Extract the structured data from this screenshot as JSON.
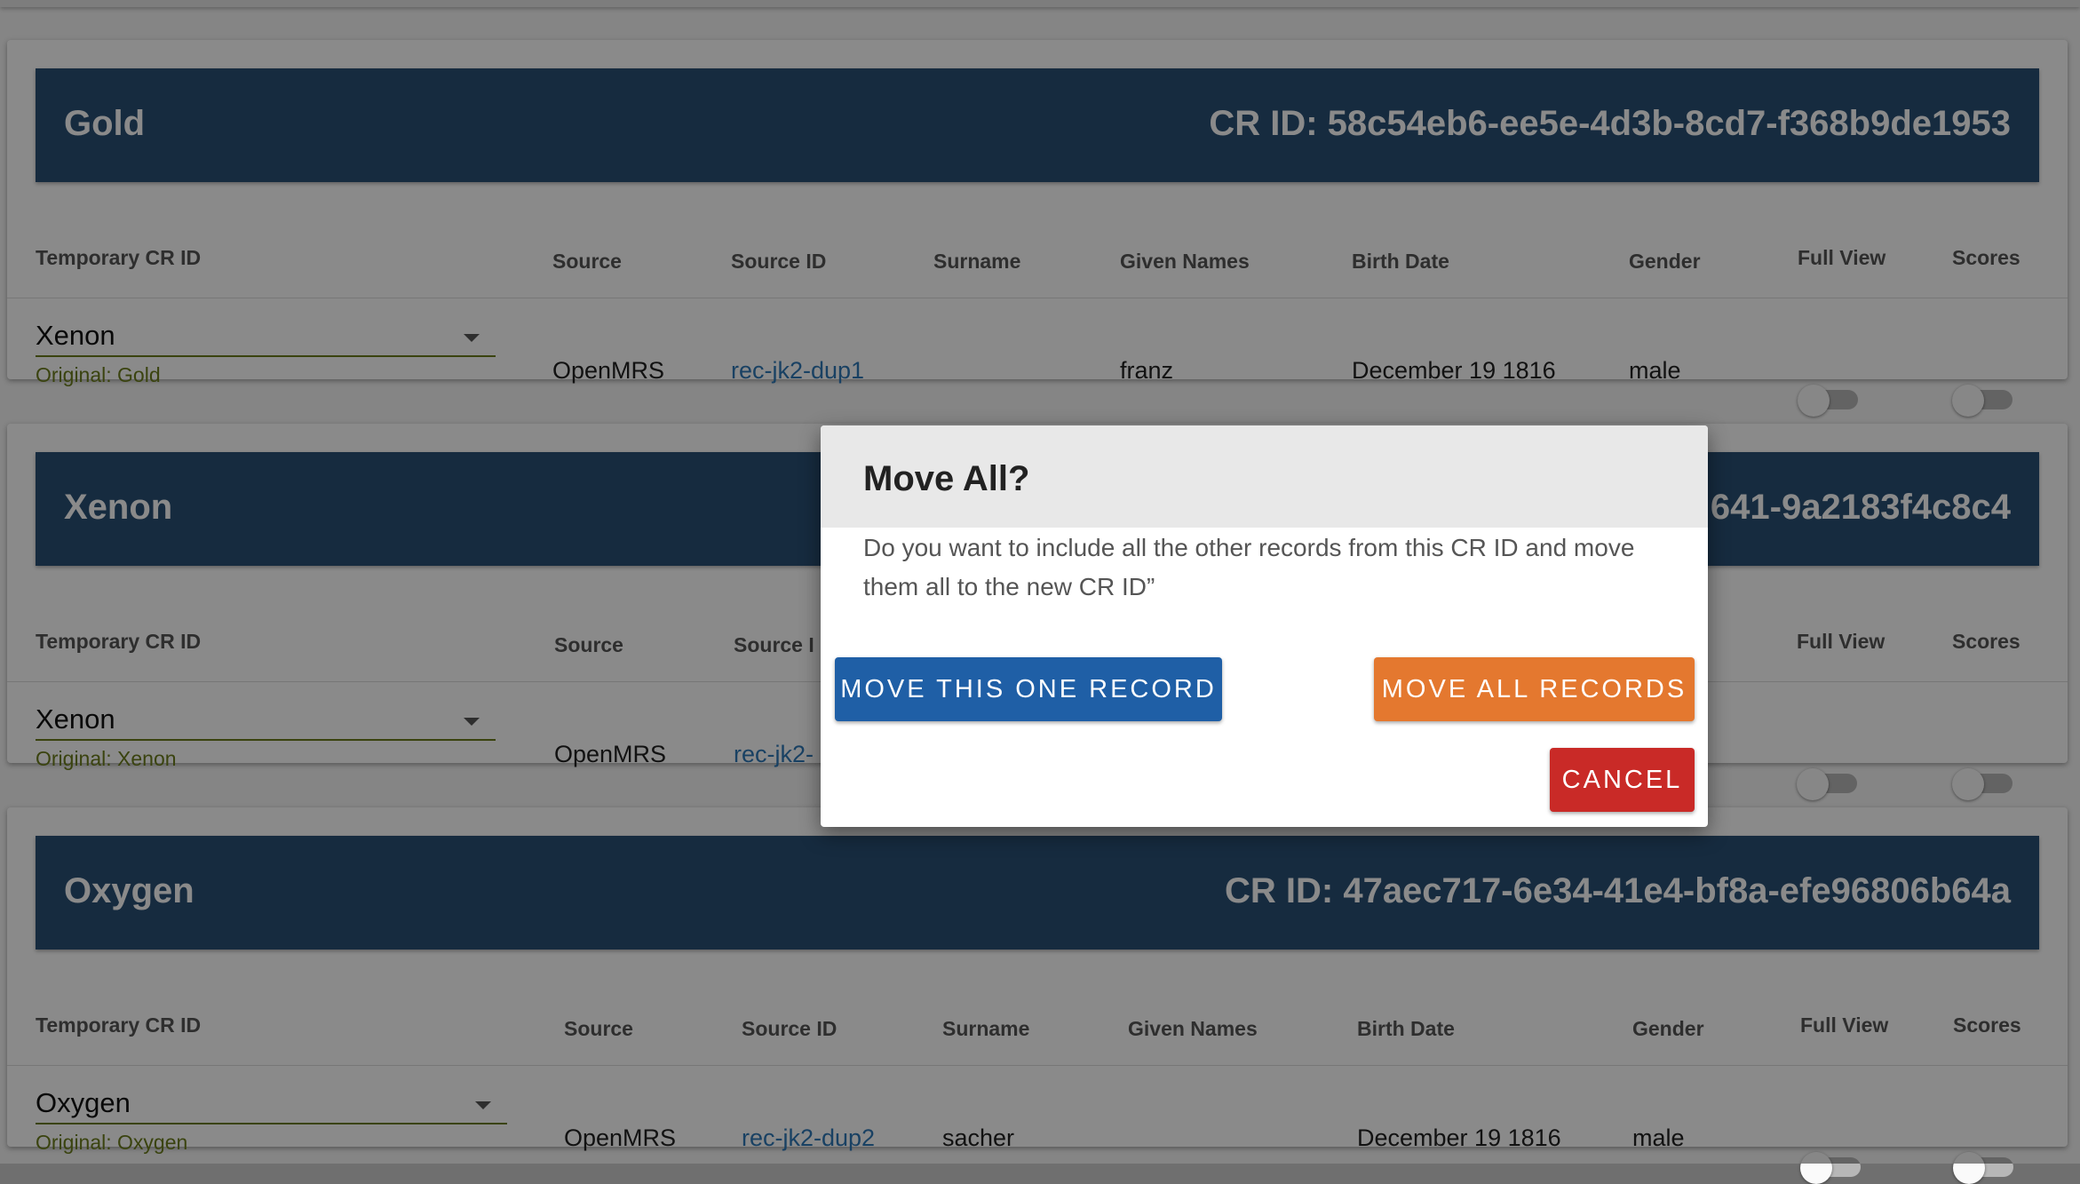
{
  "columns": {
    "temp_cr_id": "Temporary CR ID",
    "source": "Source",
    "source_id": "Source ID",
    "surname": "Surname",
    "given_names": "Given Names",
    "birth_date": "Birth Date",
    "gender": "Gender",
    "full_view": "Full View",
    "scores": "Scores"
  },
  "cards": [
    {
      "title": "Gold",
      "cr_id": "CR ID: 58c54eb6-ee5e-4d3b-8cd7-f368b9de1953",
      "record": {
        "temp_cr_id": "Xenon",
        "original": "Original: Gold",
        "source": "OpenMRS",
        "source_id": "rec-jk2-dup1",
        "surname": "",
        "given_names": "franz",
        "birth_date": "December 19 1816",
        "gender": "male",
        "full_view": false,
        "scores": false
      }
    },
    {
      "title": "Xenon",
      "cr_id": "641-9a2183f4c8c4",
      "record": {
        "temp_cr_id": "Xenon",
        "original": "Original: Xenon",
        "source": "OpenMRS",
        "source_id": "rec-jk2-",
        "surname": "",
        "given_names": "",
        "birth_date": "",
        "gender": "",
        "full_view": false,
        "scores": false
      },
      "source_id_header": "Source I"
    },
    {
      "title": "Oxygen",
      "cr_id": "CR ID: 47aec717-6e34-41e4-bf8a-efe96806b64a",
      "record": {
        "temp_cr_id": "Oxygen",
        "original": "Original: Oxygen",
        "source": "OpenMRS",
        "source_id": "rec-jk2-dup2",
        "surname": "sacher",
        "given_names": "",
        "birth_date": "December 19 1816",
        "gender": "male",
        "full_view": false,
        "scores": false
      }
    }
  ],
  "dialog": {
    "title": "Move All?",
    "body": "Do you want to include all the other records from this CR ID and move them all to the new CR ID”",
    "move_one_label": "MOVE THIS ONE RECORD",
    "move_all_label": "MOVE ALL RECORDS",
    "cancel_label": "CANCEL"
  },
  "colors": {
    "header_bg": "#2a5075",
    "link": "#2f78b7",
    "underline": "#6b7d1c",
    "move_one": "#1f5fa6",
    "move_all": "#e4782f",
    "cancel": "#c92a27"
  }
}
